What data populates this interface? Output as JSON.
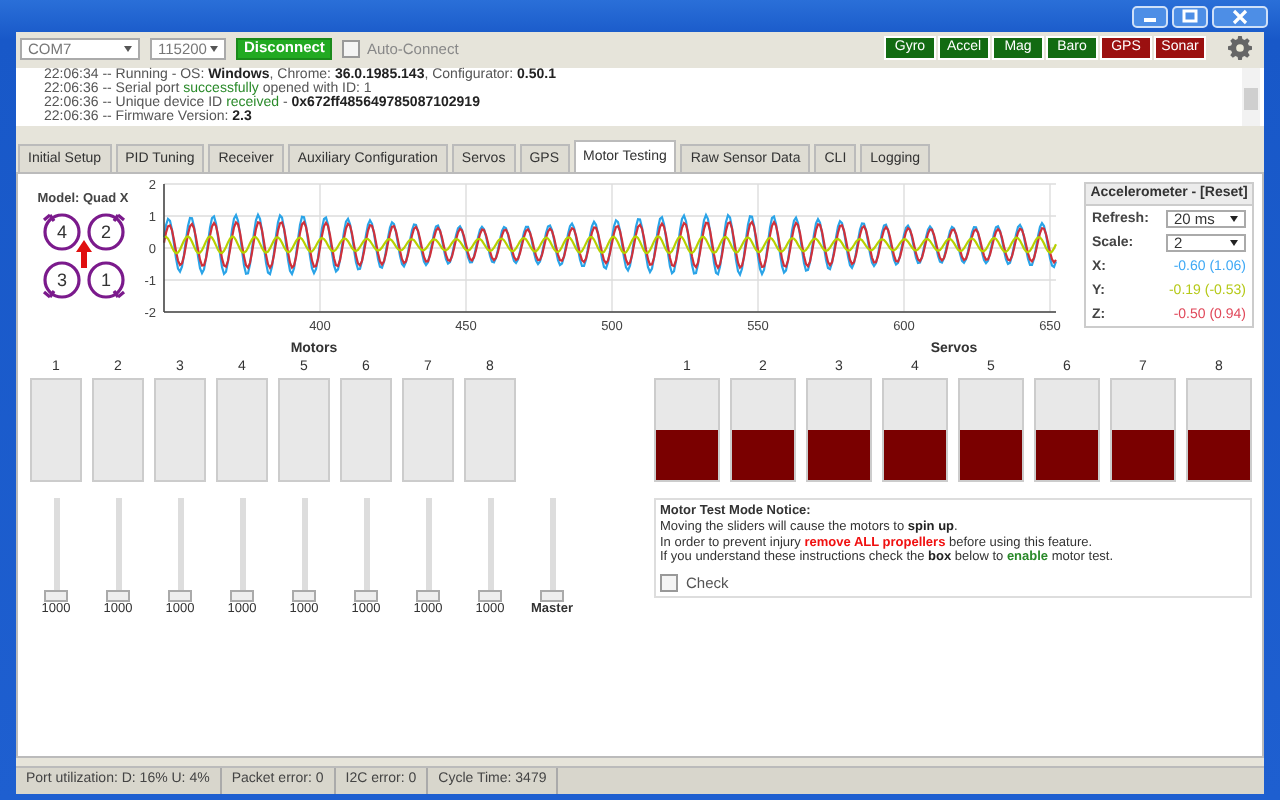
{
  "toolbar": {
    "port": "COM7",
    "baud": "115200",
    "connect_button": "Disconnect",
    "auto_connect": {
      "label": "Auto-Connect",
      "checked": false
    }
  },
  "sensors": [
    {
      "label": "Gyro",
      "on": true
    },
    {
      "label": "Accel",
      "on": true
    },
    {
      "label": "Mag",
      "on": true
    },
    {
      "label": "Baro",
      "on": true
    },
    {
      "label": "GPS",
      "on": false
    },
    {
      "label": "Sonar",
      "on": false
    }
  ],
  "log": [
    [
      {
        "text": "22:06:34 -- Running - OS: ",
        "kind": "plain"
      },
      {
        "text": "Windows",
        "kind": "bold"
      },
      {
        "text": ", Chrome: ",
        "kind": "plain"
      },
      {
        "text": "36.0.1985.143",
        "kind": "bold"
      },
      {
        "text": ", Configurator: ",
        "kind": "plain"
      },
      {
        "text": "0.50.1",
        "kind": "bold"
      }
    ],
    [
      {
        "text": "22:06:36 -- Serial port ",
        "kind": "plain"
      },
      {
        "text": "successfully",
        "kind": "green"
      },
      {
        "text": " opened with ID: 1",
        "kind": "plain"
      }
    ],
    [
      {
        "text": "22:06:36 -- Unique device ID ",
        "kind": "plain"
      },
      {
        "text": "received",
        "kind": "green"
      },
      {
        "text": " - ",
        "kind": "plain"
      },
      {
        "text": "0x672ff485649785087102919",
        "kind": "bold"
      }
    ],
    [
      {
        "text": "22:06:36 -- Firmware Version: ",
        "kind": "plain"
      },
      {
        "text": "2.3",
        "kind": "bold"
      }
    ]
  ],
  "tabs": [
    {
      "label": "Initial Setup",
      "selected": false
    },
    {
      "label": "PID Tuning",
      "selected": false
    },
    {
      "label": "Receiver",
      "selected": false
    },
    {
      "label": "Auxiliary Configuration",
      "selected": false
    },
    {
      "label": "Servos",
      "selected": false
    },
    {
      "label": "GPS",
      "selected": false
    },
    {
      "label": "Motor Testing",
      "selected": true
    },
    {
      "label": "Raw Sensor Data",
      "selected": false
    },
    {
      "label": "CLI",
      "selected": false
    },
    {
      "label": "Logging",
      "selected": false
    }
  ],
  "model": {
    "title": "Model: Quad X",
    "motors": [
      "4",
      "2",
      "3",
      "1"
    ]
  },
  "graph": {
    "yticks": [
      "2",
      "1",
      "0",
      "-1",
      "-2"
    ],
    "xticks": [
      "400",
      "450",
      "500",
      "550",
      "600",
      "650"
    ]
  },
  "accelerometer": {
    "title": "Accelerometer - [Reset]",
    "refresh": {
      "label": "Refresh:",
      "value": "20 ms"
    },
    "scale": {
      "label": "Scale:",
      "value": "2"
    },
    "axes": [
      {
        "label": "X:",
        "reading": "-0.60 (1.06)",
        "color": "#3fa9f5"
      },
      {
        "label": "Y:",
        "reading": "-0.19 (-0.53)",
        "color": "#b5c918"
      },
      {
        "label": "Z:",
        "reading": "-0.50 (0.94)",
        "color": "#e0485a"
      }
    ]
  },
  "motors": {
    "title": "Motors",
    "channels": [
      {
        "label": "1",
        "bar": {
          "level": 0
        },
        "slider": {
          "level": 0
        },
        "value": "1000"
      },
      {
        "label": "2",
        "bar": {
          "level": 0
        },
        "slider": {
          "level": 0
        },
        "value": "1000"
      },
      {
        "label": "3",
        "bar": {
          "level": 0
        },
        "slider": {
          "level": 0
        },
        "value": "1000"
      },
      {
        "label": "4",
        "bar": {
          "level": 0
        },
        "slider": {
          "level": 0
        },
        "value": "1000"
      },
      {
        "label": "5",
        "bar": {
          "level": 0
        },
        "slider": {
          "level": 0
        },
        "value": "1000"
      },
      {
        "label": "6",
        "bar": {
          "level": 0
        },
        "slider": {
          "level": 0
        },
        "value": "1000"
      },
      {
        "label": "7",
        "bar": {
          "level": 0
        },
        "slider": {
          "level": 0
        },
        "value": "1000"
      },
      {
        "label": "8",
        "bar": {
          "level": 0
        },
        "slider": {
          "level": 0
        },
        "value": "1000"
      }
    ],
    "master": {
      "label": "Master",
      "level": 0
    }
  },
  "servos": {
    "title": "Servos",
    "channels": [
      {
        "label": "1",
        "level": 0.5
      },
      {
        "label": "2",
        "level": 0.5
      },
      {
        "label": "3",
        "level": 0.5
      },
      {
        "label": "4",
        "level": 0.5
      },
      {
        "label": "5",
        "level": 0.5
      },
      {
        "label": "6",
        "level": 0.5
      },
      {
        "label": "7",
        "level": 0.5
      },
      {
        "label": "8",
        "level": 0.5
      }
    ]
  },
  "notice": {
    "title": "Motor Test Mode Notice:",
    "lines": [
      [
        {
          "text": "Moving the sliders will cause the motors to ",
          "kind": "plain"
        },
        {
          "text": "spin up",
          "kind": "bold"
        },
        {
          "text": ".",
          "kind": "plain"
        }
      ],
      [
        {
          "text": "In order to prevent injury ",
          "kind": "plain"
        },
        {
          "text": "remove ALL propellers",
          "kind": "red-bold"
        },
        {
          "text": " before using this feature.",
          "kind": "plain"
        }
      ],
      [
        {
          "text": "If you understand these instructions check the ",
          "kind": "plain"
        },
        {
          "text": "box",
          "kind": "bold"
        },
        {
          "text": " below to ",
          "kind": "plain"
        },
        {
          "text": "enable",
          "kind": "green-bold"
        },
        {
          "text": " motor test.",
          "kind": "plain"
        }
      ]
    ],
    "check": {
      "label": "Check",
      "checked": false
    }
  },
  "status_bar": [
    "Port utilization: D: 16% U: 4%",
    "Packet error: 0",
    "I2C error: 0",
    "Cycle Time: 3479"
  ]
}
